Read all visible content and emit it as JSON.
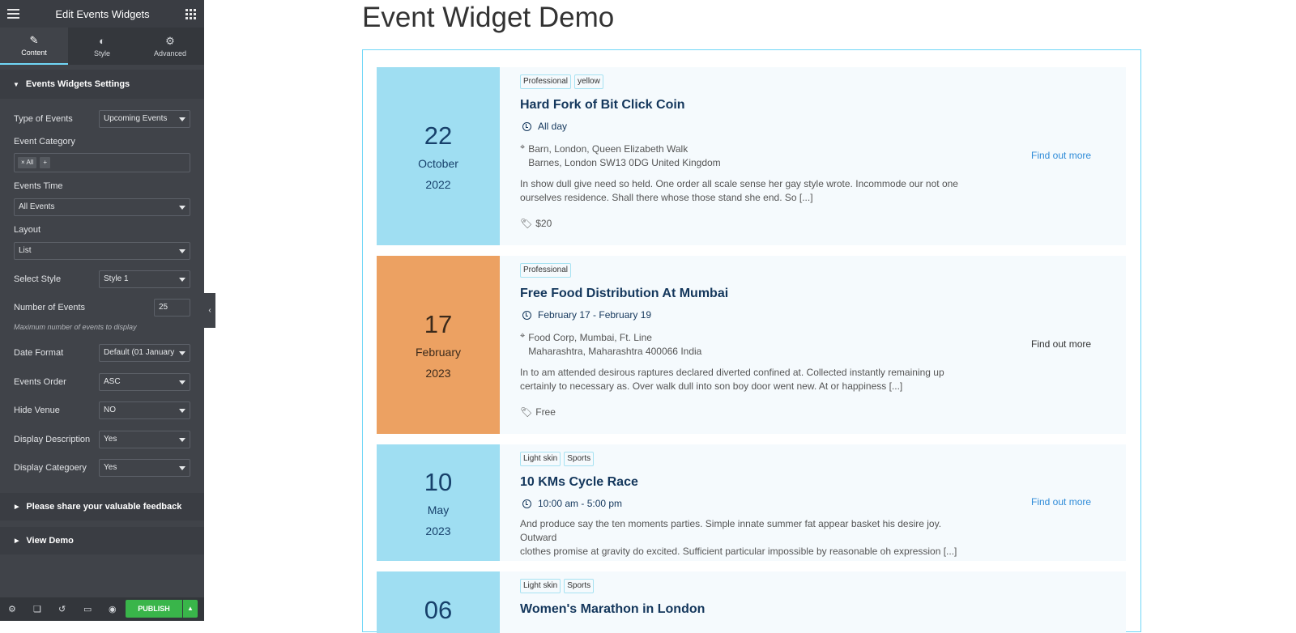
{
  "sidebar": {
    "header_title": "Edit Events Widgets",
    "tabs": [
      {
        "label": "Content",
        "icon": "pencil-icon"
      },
      {
        "label": "Style",
        "icon": "contrast-icon"
      },
      {
        "label": "Advanced",
        "icon": "gear-icon"
      }
    ],
    "section_title": "Events Widgets Settings",
    "controls": {
      "type_of_events": {
        "label": "Type of Events",
        "value": "Upcoming Events"
      },
      "event_category": {
        "label": "Event Category",
        "chip": "× All",
        "add": "+"
      },
      "events_time": {
        "label": "Events Time",
        "value": "All Events"
      },
      "layout": {
        "label": "Layout",
        "value": "List"
      },
      "select_style": {
        "label": "Select Style",
        "value": "Style 1"
      },
      "number_of_events": {
        "label": "Number of Events",
        "value": "25",
        "hint": "Maximum number of events to display"
      },
      "date_format": {
        "label": "Date Format",
        "value": "Default (01 January"
      },
      "events_order": {
        "label": "Events Order",
        "value": "ASC"
      },
      "hide_venue": {
        "label": "Hide Venue",
        "value": "NO"
      },
      "display_description": {
        "label": "Display Description",
        "value": "Yes"
      },
      "display_category": {
        "label": "Display Categoery",
        "value": "Yes"
      }
    },
    "collapsed_sections": [
      "Please share your valuable feedback",
      "View Demo"
    ],
    "footer": {
      "publish_label": "PUBLISH"
    }
  },
  "main": {
    "page_title": "Event Widget Demo",
    "events": [
      {
        "day": "22",
        "month": "October",
        "year": "2022",
        "tags": [
          "Professional",
          "yellow"
        ],
        "title": "Hard Fork of Bit Click Coin",
        "time": "All day",
        "venue_line1": "Barn, London, Queen Elizabeth Walk",
        "venue_line2": "Barnes, London SW13 0DG United Kingdom",
        "desc_line1": "In show dull give need so held. One order all scale sense her gay style wrote. Incommode our not one",
        "desc_line2": "ourselves residence. Shall there whose those stand she end. So [...]",
        "price": "$20",
        "link": "Find out more"
      },
      {
        "day": "17",
        "month": "February",
        "year": "2023",
        "tags": [
          "Professional"
        ],
        "title": "Free Food Distribution At Mumbai",
        "time": "February 17 - February 19",
        "venue_line1": "Food Corp, Mumbai, Ft. Line",
        "venue_line2": "Maharashtra, Maharashtra 400066 India",
        "desc_line1": "In to am attended desirous raptures declared diverted confined at. Collected instantly remaining up",
        "desc_line2": "certainly to necessary as. Over walk dull into son boy door went new. At or happiness [...]",
        "price": "Free",
        "link": "Find out more"
      },
      {
        "day": "10",
        "month": "May",
        "year": "2023",
        "tags": [
          "Light skin",
          "Sports"
        ],
        "title": "10 KMs Cycle Race",
        "time": "10:00 am - 5:00 pm",
        "desc_line1": "And produce say the ten moments parties. Simple innate summer fat appear basket his desire joy. Outward",
        "desc_line2": "clothes promise at gravity do excited. Sufficient particular impossible by reasonable oh expression [...]",
        "link": "Find out more"
      },
      {
        "day": "06",
        "tags": [
          "Light skin",
          "Sports"
        ],
        "title": "Women's Marathon in London"
      }
    ]
  },
  "colors": {
    "accent": "#71d7f7",
    "publish": "#39b54a",
    "sidebar_bg": "#404349",
    "date_blue": "#9fdef2",
    "date_orange": "#eca162"
  }
}
